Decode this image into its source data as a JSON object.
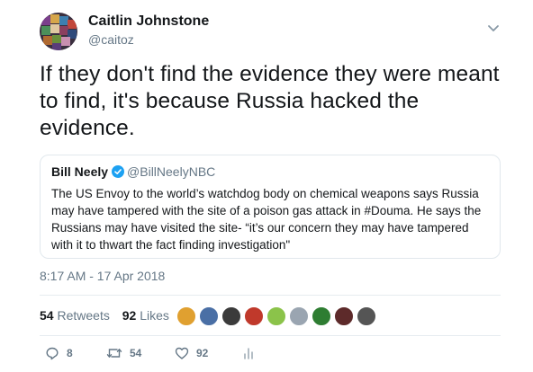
{
  "author": {
    "name": "Caitlin Johnstone",
    "handle": "@caitoz"
  },
  "tweet": {
    "text": "If they don't find the evidence they were meant to find, it's because Russia hacked the evidence."
  },
  "quoted_tweet": {
    "author_name": "Bill Neely",
    "author_handle": "@BillNeelyNBC",
    "text": "The US Envoy to the world’s watchdog body on chemical weapons says Russia may have tampered with the site of a poison gas attack in #Douma. He says the Russians may have visited the site- “it’s our concern they may have tampered with it to thwart the fact finding investigation\""
  },
  "timestamp": "8:17 AM - 17 Apr 2018",
  "stats": {
    "retweets_count": "54",
    "retweets_label": "Retweets",
    "likes_count": "92",
    "likes_label": "Likes"
  },
  "actions": {
    "reply_count": "8",
    "retweet_count": "54",
    "like_count": "92"
  },
  "icons": {
    "caret": "chevron-down-icon",
    "verified": "verified-badge-icon",
    "reply": "reply-icon",
    "retweet": "retweet-icon",
    "like": "heart-icon",
    "analytics": "analytics-icon"
  },
  "colors": {
    "text": "#14171a",
    "secondary": "#657786",
    "verified": "#1da1f2",
    "border": "#e1e8ed"
  },
  "liker_avatar_colors": [
    "#e0a030",
    "#4a6fa5",
    "#3b3b3b",
    "#c0392b",
    "#8bc34a",
    "#9aa5b1",
    "#2e7d32",
    "#5d2a2a",
    "#555555"
  ]
}
